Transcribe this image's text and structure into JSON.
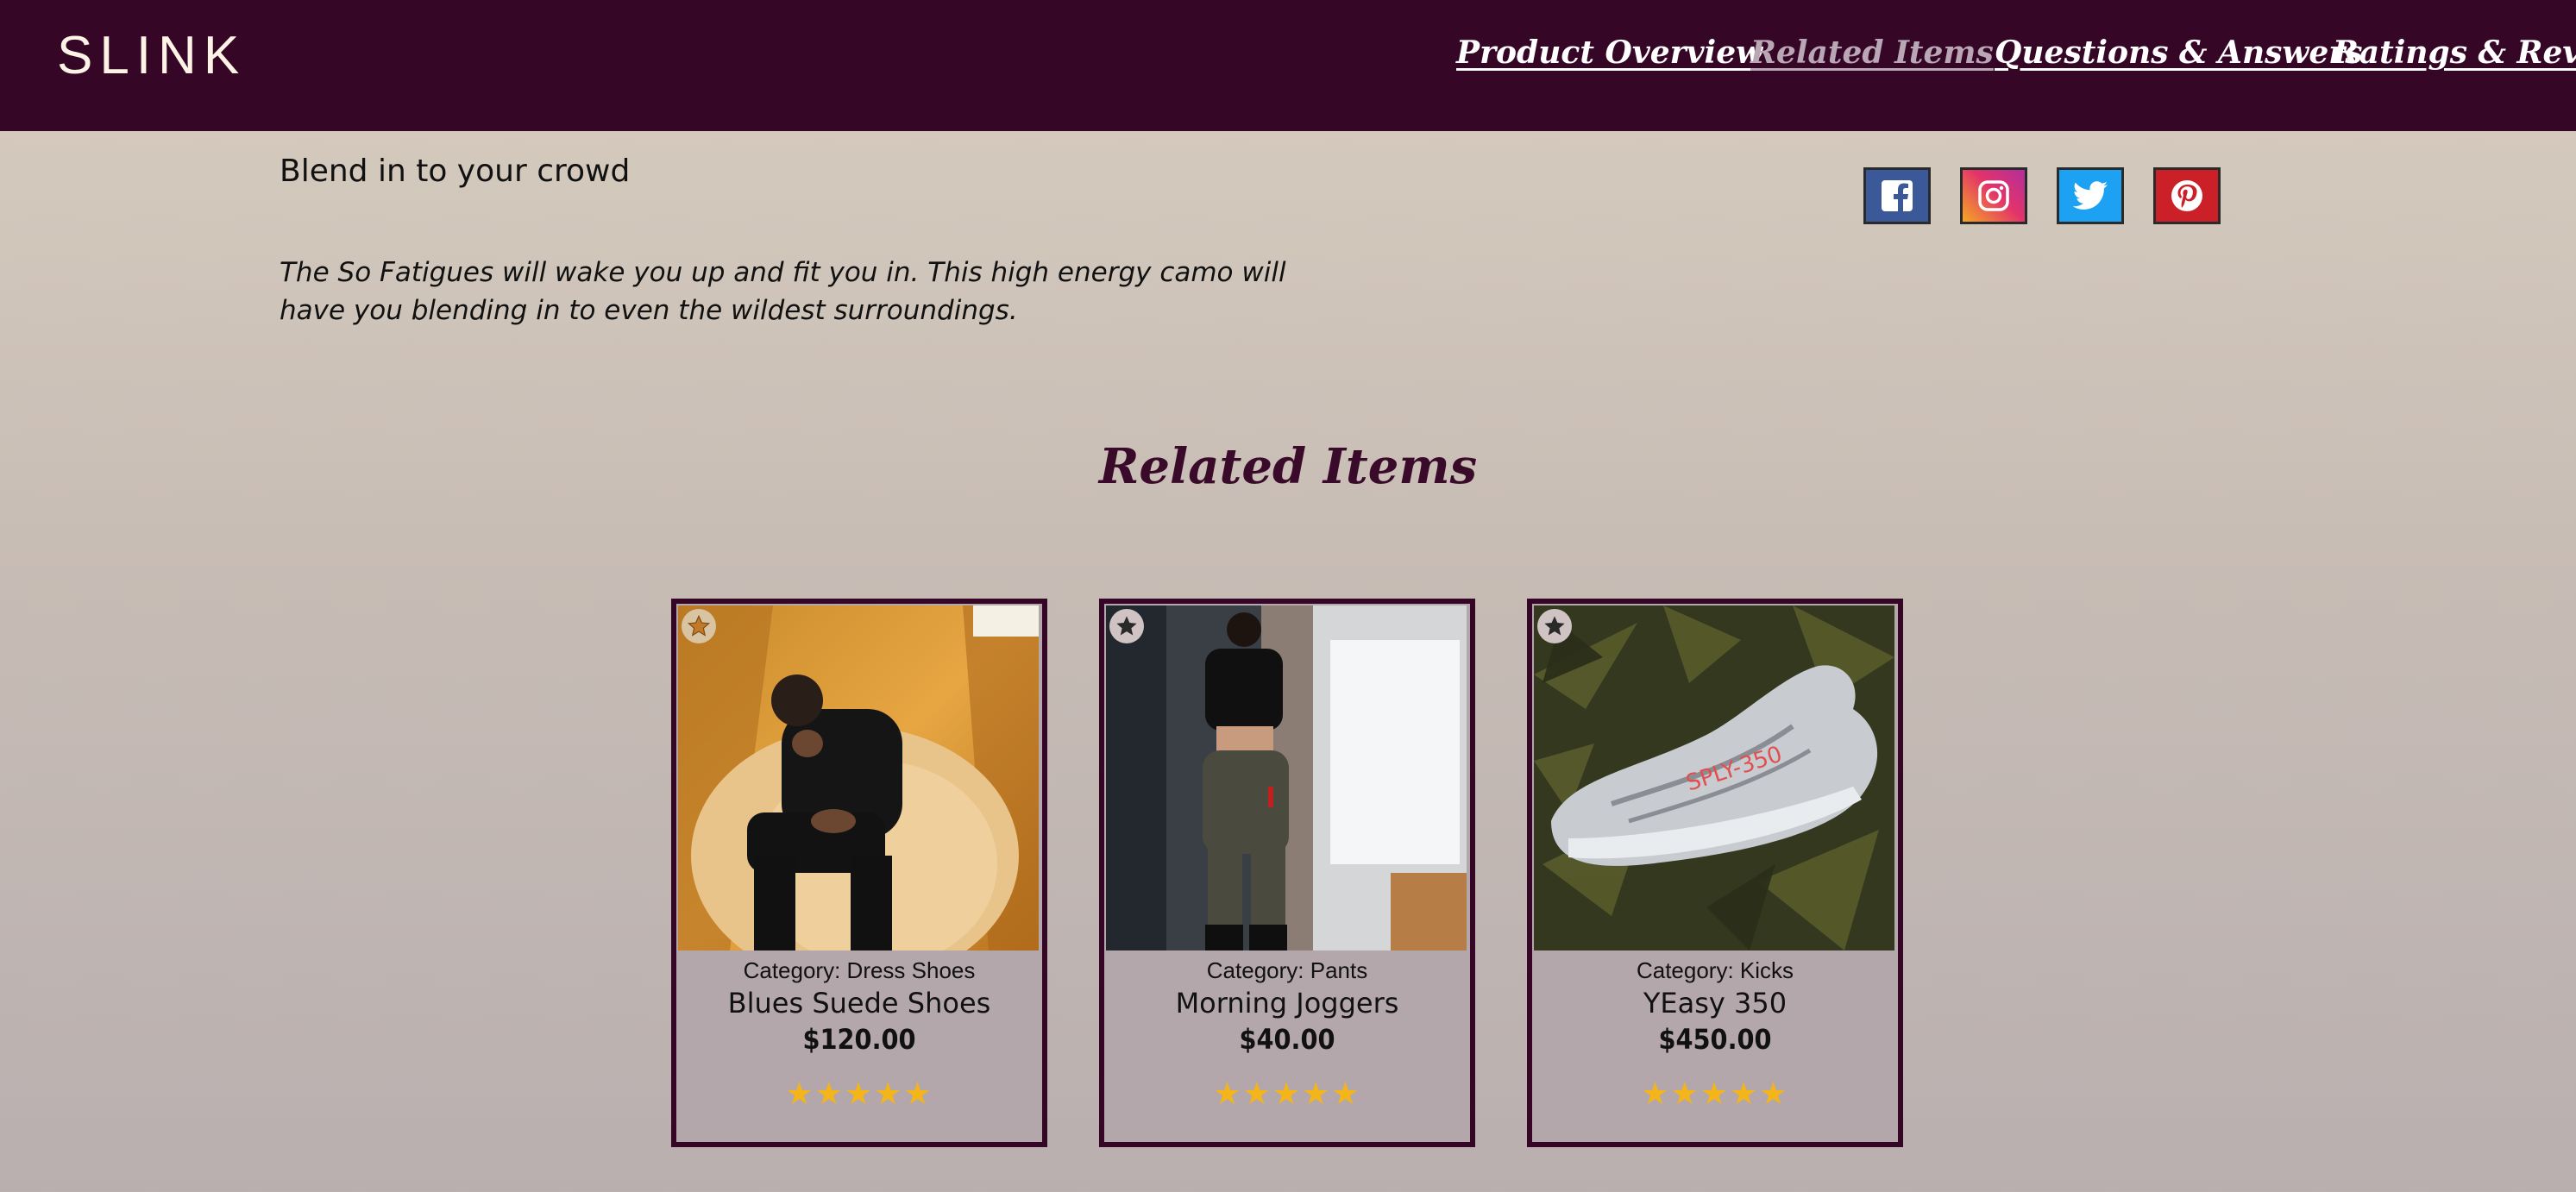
{
  "header": {
    "brand": "SLINK",
    "nav": [
      {
        "label": "Product Overview"
      },
      {
        "label": "Related Items"
      },
      {
        "label": "Questions & Answers"
      },
      {
        "label": "Ratings & Reviews"
      }
    ]
  },
  "product": {
    "slogan": "Blend in to your crowd",
    "description": "The So Fatigues will wake you up and fit you in. This high energy camo will have you blending in to even the wildest surroundings."
  },
  "social": [
    {
      "icon": "facebook-icon",
      "color": "#3b5998"
    },
    {
      "icon": "instagram-icon",
      "color": "#e2336b"
    },
    {
      "icon": "twitter-icon",
      "color": "#1da1f2"
    },
    {
      "icon": "pinterest-icon",
      "color": "#cb2027"
    }
  ],
  "related": {
    "title": "Related Items",
    "cards": [
      {
        "category": "Category: Dress Shoes",
        "name": "Blues Suede Shoes",
        "price": "$120.00",
        "rating": 5,
        "stars": "★★★★★",
        "photo": "man seated on furry orange chair"
      },
      {
        "category": "Category: Pants",
        "name": "Morning Joggers",
        "price": "$40.00",
        "rating": 5,
        "stars": "★★★★★",
        "photo": "woman in black crop top and joggers"
      },
      {
        "category": "Category: Kicks",
        "name": "YEasy 350",
        "price": "$450.00",
        "rating": 5,
        "stars": "★★★★★",
        "photo": "grey zebra sneaker on green leaves"
      }
    ]
  },
  "colors": {
    "header_bg": "#360627",
    "accent": "#3a0a2a",
    "star": "#f3b51a",
    "card_bg": "#b3a7ab"
  }
}
